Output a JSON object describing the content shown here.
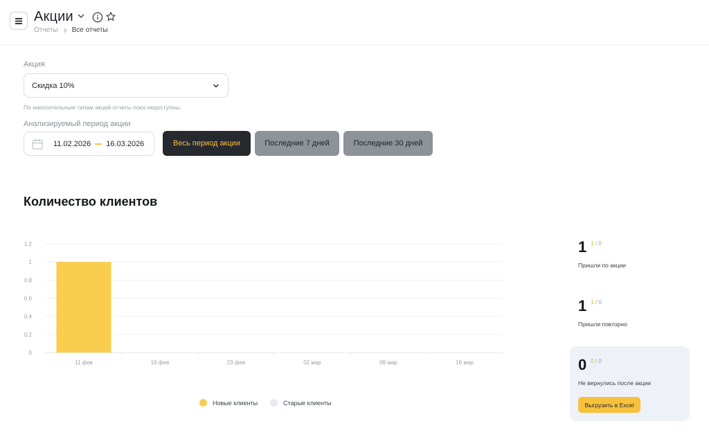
{
  "header": {
    "title": "Акции",
    "breadcrumb": {
      "parent": "Отчеты",
      "current": "Все отчеты"
    }
  },
  "form": {
    "promo_label": "Акция",
    "promo_value": "Скидка 10%",
    "hint": "По накопительным типам акций отчеты пока недоступны.",
    "period_label": "Анализируемый период акции",
    "date_from": "11.02.2026",
    "date_to": "16.03.2026",
    "period_buttons": [
      {
        "label": "Весь период акции",
        "active": true
      },
      {
        "label": "Последние 7 дней",
        "active": false
      },
      {
        "label": "Последние 30 дней",
        "active": false
      }
    ]
  },
  "section_title": "Количество клиентов",
  "chart_data": {
    "type": "bar",
    "title": "",
    "xlabel": "",
    "ylabel": "",
    "categories": [
      "11 фев",
      "16 фев",
      "23 фев",
      "02 мар",
      "09 мар",
      "16 мар"
    ],
    "series": [
      {
        "name": "Новые клиенты",
        "values": [
          1,
          0,
          0,
          0,
          0,
          0
        ],
        "color": "#f9cd4e"
      },
      {
        "name": "Старые клиенты",
        "values": [
          0,
          0,
          0,
          0,
          0,
          0
        ],
        "color": "#e6e9f2"
      }
    ],
    "y_ticks": [
      "0",
      "0.2",
      "0.4",
      "0.6",
      "0.8",
      "1",
      "1.2"
    ],
    "ylim": [
      0,
      1.2
    ],
    "grid": true,
    "legend": "bottom"
  },
  "stats": [
    {
      "value": "1",
      "sub_a": "1",
      "sub_b": "0",
      "caption": "Пришли по акции"
    },
    {
      "value": "1",
      "sub_a": "1",
      "sub_b": "0",
      "caption": "Пришли повторно"
    },
    {
      "value": "0",
      "sub_a": "0",
      "sub_b": "0",
      "caption": "Не вернулись после акции"
    }
  ],
  "excel_button": "Выгрузить в Excel",
  "colors": {
    "accent": "#f6c23e",
    "dark": "#26292e",
    "muted_button": "#8e9299"
  }
}
